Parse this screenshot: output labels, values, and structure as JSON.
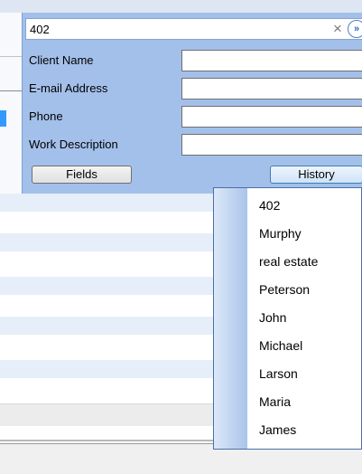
{
  "search": {
    "value": "402"
  },
  "fields": [
    {
      "label": "Client Name",
      "value": ""
    },
    {
      "label": "E-mail Address",
      "value": ""
    },
    {
      "label": "Phone",
      "value": ""
    },
    {
      "label": "Work Description",
      "value": ""
    }
  ],
  "buttons": {
    "fields": "Fields",
    "history": "History"
  },
  "history": {
    "items": [
      "402",
      "Murphy",
      "real estate",
      "Peterson",
      "John",
      "Michael",
      "Larson",
      "Maria",
      "James"
    ]
  },
  "icons": {
    "clear": "close-icon",
    "go": "go-icon"
  },
  "colors": {
    "panel": "#a3c0ea",
    "row_alt": "#e6eef9",
    "menu_border": "#4a6ea9"
  }
}
